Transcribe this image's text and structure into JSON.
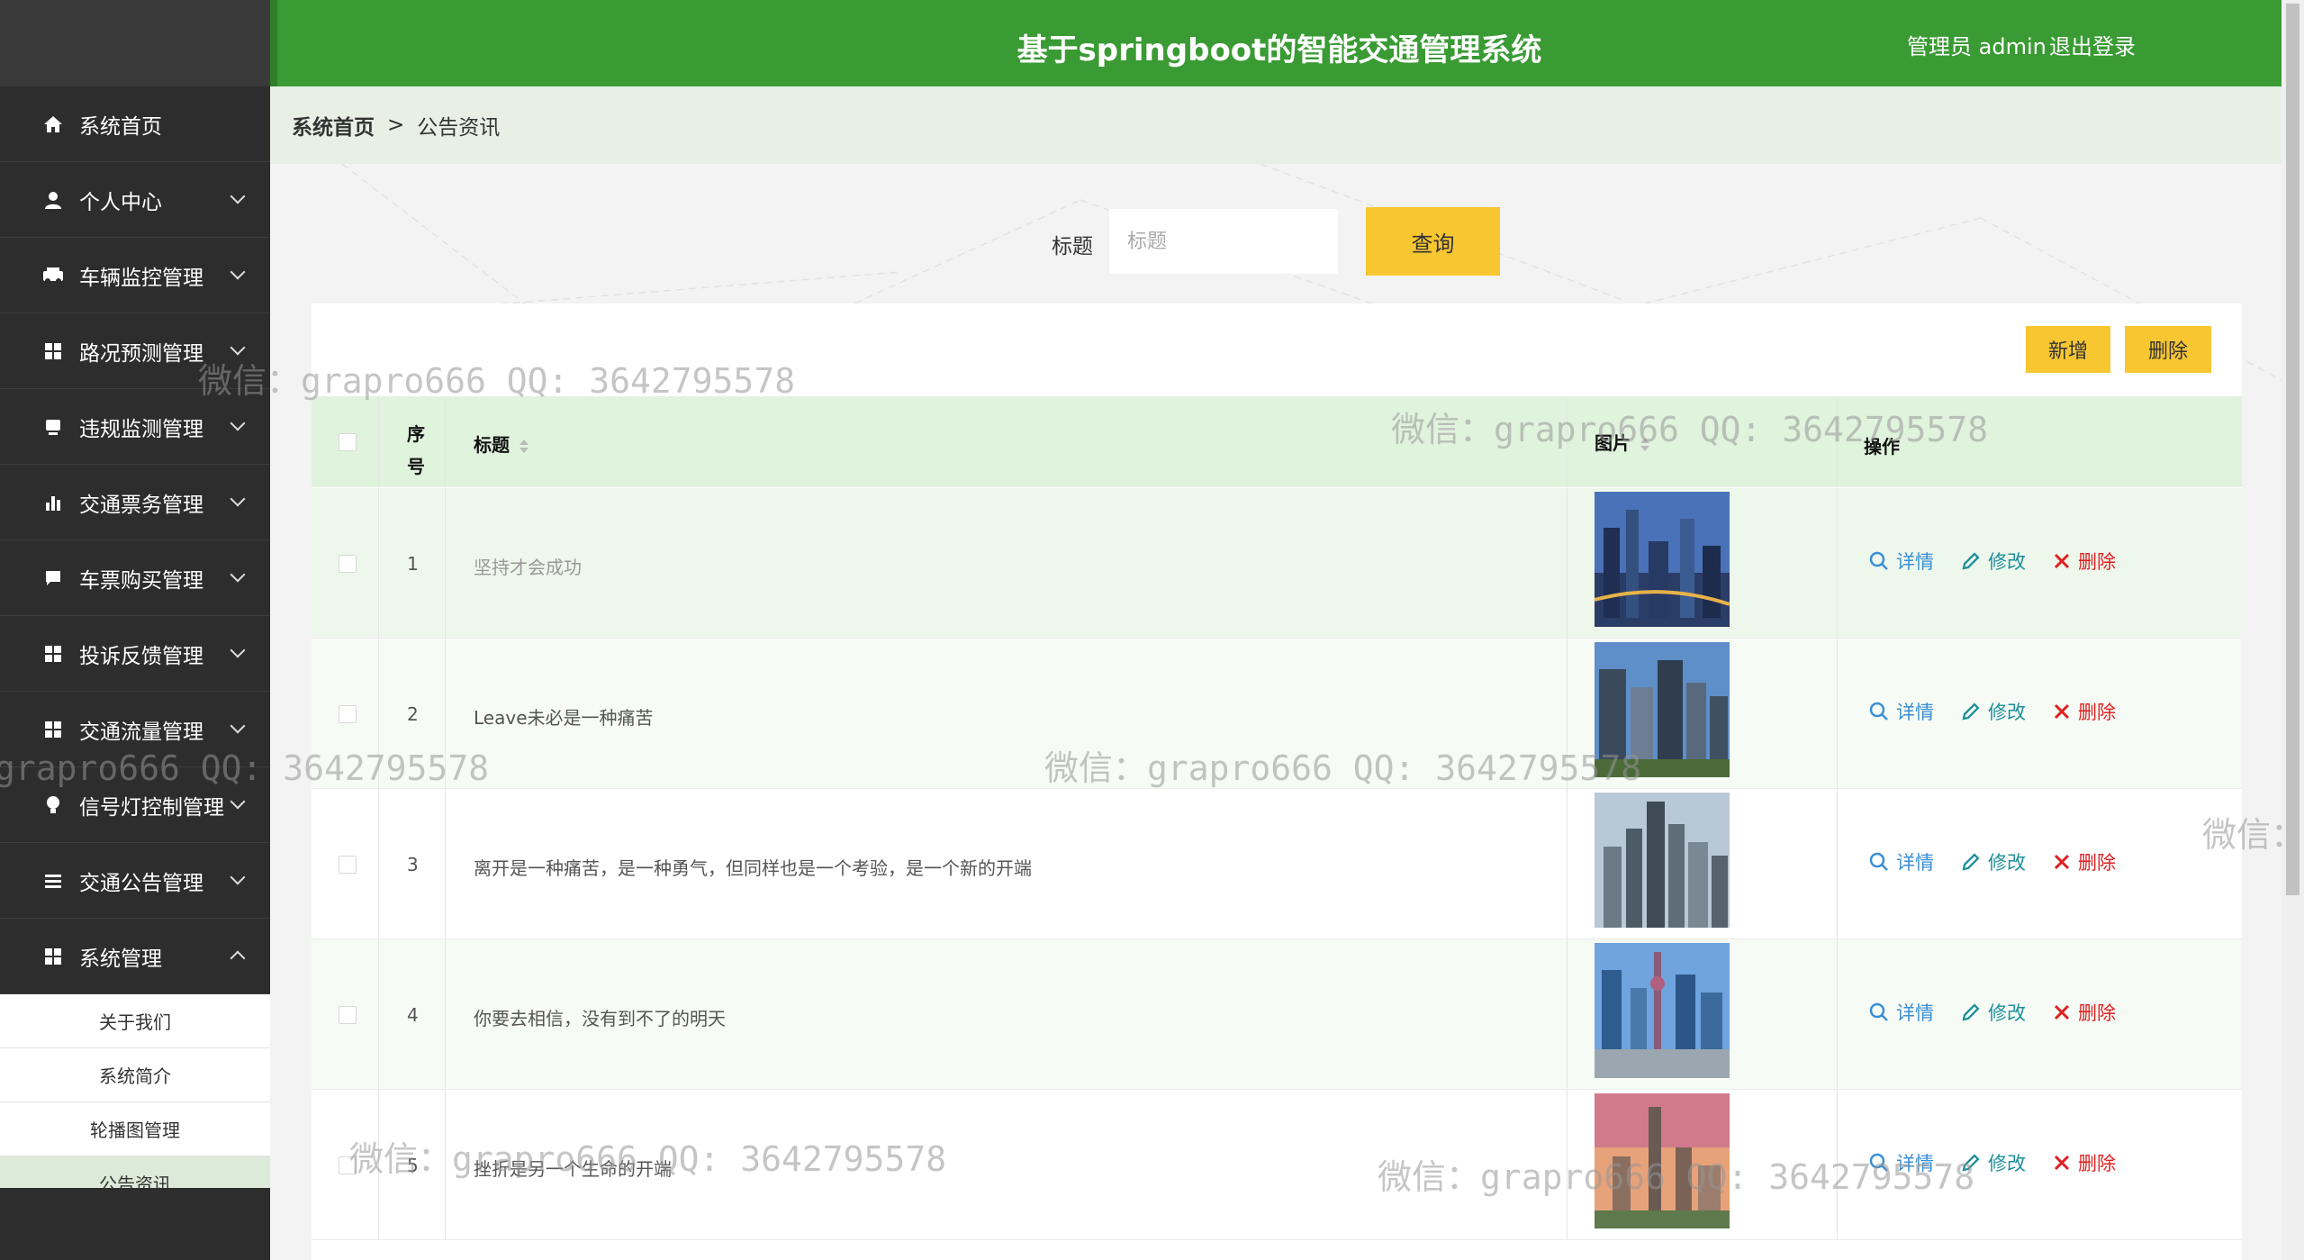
{
  "header": {
    "title": "基于springboot的智能交通管理系统",
    "user": "管理员 admin",
    "logout": "退出登录"
  },
  "sidebar": {
    "items": [
      {
        "label": "系统首页",
        "icon": "home-icon"
      },
      {
        "label": "个人中心",
        "icon": "user-icon"
      },
      {
        "label": "车辆监控管理",
        "icon": "car-icon"
      },
      {
        "label": "路况预测管理",
        "icon": "grid-icon"
      },
      {
        "label": "违规监测管理",
        "icon": "monitor-icon"
      },
      {
        "label": "交通票务管理",
        "icon": "bar-chart-icon"
      },
      {
        "label": "车票购买管理",
        "icon": "message-icon"
      },
      {
        "label": "投诉反馈管理",
        "icon": "grid-icon"
      },
      {
        "label": "交通流量管理",
        "icon": "grid-icon"
      },
      {
        "label": "信号灯控制管理",
        "icon": "bulb-icon"
      },
      {
        "label": "交通公告管理",
        "icon": "list-icon"
      },
      {
        "label": "系统管理",
        "icon": "grid-icon"
      }
    ],
    "sub_items": [
      "关于我们",
      "系统简介",
      "轮播图管理",
      "公告资讯"
    ]
  },
  "breadcrumb": {
    "home": "系统首页",
    "separator": ">",
    "current": "公告资讯"
  },
  "search": {
    "label": "标题",
    "placeholder": "标题",
    "button": "查询"
  },
  "toolbar": {
    "add": "新增",
    "delete": "删除"
  },
  "table": {
    "headers": {
      "index": "序号",
      "title": "标题",
      "image": "图片",
      "actions": "操作"
    },
    "actions": {
      "detail": "详情",
      "edit": "修改",
      "delete": "删除"
    },
    "rows": [
      {
        "index": "1",
        "title": "坚持才会成功"
      },
      {
        "index": "2",
        "title": "Leave未必是一种痛苦"
      },
      {
        "index": "3",
        "title": "离开是一种痛苦，是一种勇气，但同样也是一个考验，是一个新的开端"
      },
      {
        "index": "4",
        "title": "你要去相信，没有到不了的明天"
      },
      {
        "index": "5",
        "title": "挫折是另一个生命的开端"
      }
    ]
  },
  "watermark": "微信：grapro666 QQ: 3642795578"
}
